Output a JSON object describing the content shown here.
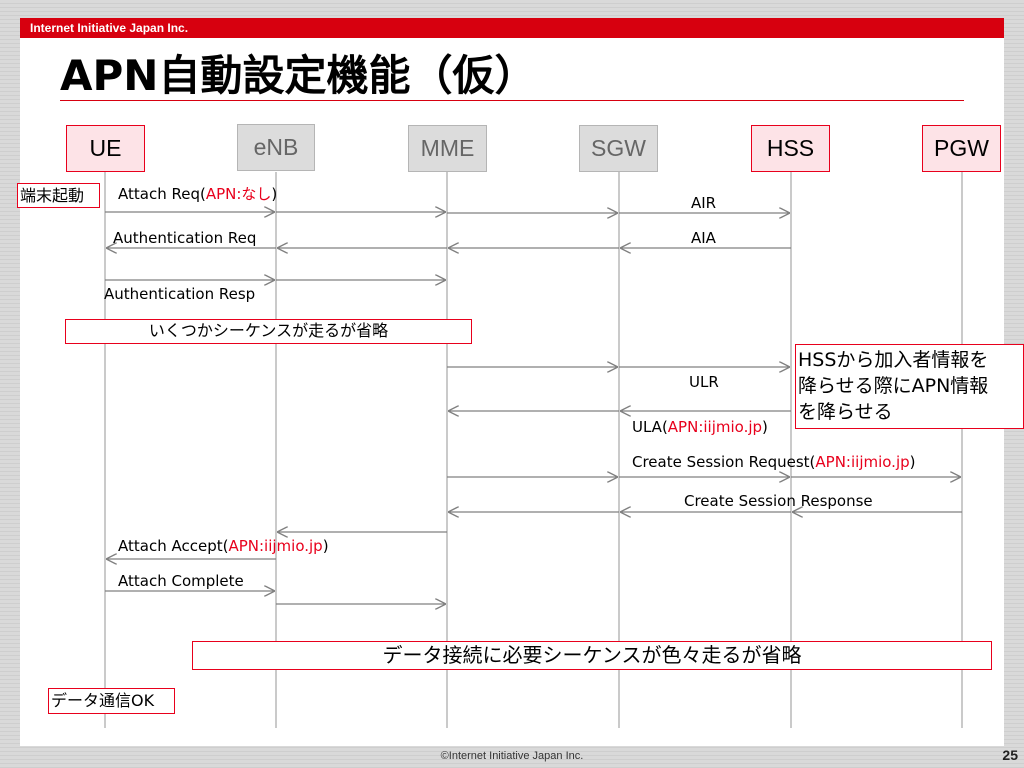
{
  "header": {
    "company": "Internet Initiative Japan Inc.",
    "title": "APN自動設定機能（仮）"
  },
  "actors": {
    "ue": "UE",
    "enb": "eNB",
    "mme": "MME",
    "sgw": "SGW",
    "hss": "HSS",
    "pgw": "PGW"
  },
  "notes": {
    "terminal_start": "端末起動",
    "sequence_omitted": "いくつかシーケンスが走るが省略",
    "hss_note": [
      "HSSから加入者情報を",
      "降らせる際にAPN情報",
      "を降らせる"
    ],
    "data_seq_omitted": "データ接続に必要シーケンスが色々走るが省略",
    "data_ok": "データ通信OK"
  },
  "messages": {
    "attach_req": {
      "text": "Attach Req(",
      "apn": "APN:なし",
      "close": ")"
    },
    "air": "AIR",
    "auth_req": "Authentication Req",
    "aia": "AIA",
    "auth_resp": "Authentication Resp",
    "ulr": "ULR",
    "ula": {
      "text": "ULA(",
      "apn": "APN:iijmio.jp",
      "close": ")"
    },
    "create_session_req": {
      "text": "Create Session Request(",
      "apn": "APN:iijmio.jp",
      "close": ")"
    },
    "create_session_resp": "Create Session Response",
    "attach_accept": {
      "text": "Attach Accept(",
      "apn": "APN:iijmio.jp",
      "close": ")"
    },
    "attach_complete": "Attach Complete"
  },
  "footer": {
    "copyright": "©Internet Initiative Japan Inc.",
    "page": "25"
  },
  "colors": {
    "accent": "#e8001c",
    "topbar": "#d7000f",
    "lifeline": "#a6a6a6",
    "arrow": "#808080"
  }
}
